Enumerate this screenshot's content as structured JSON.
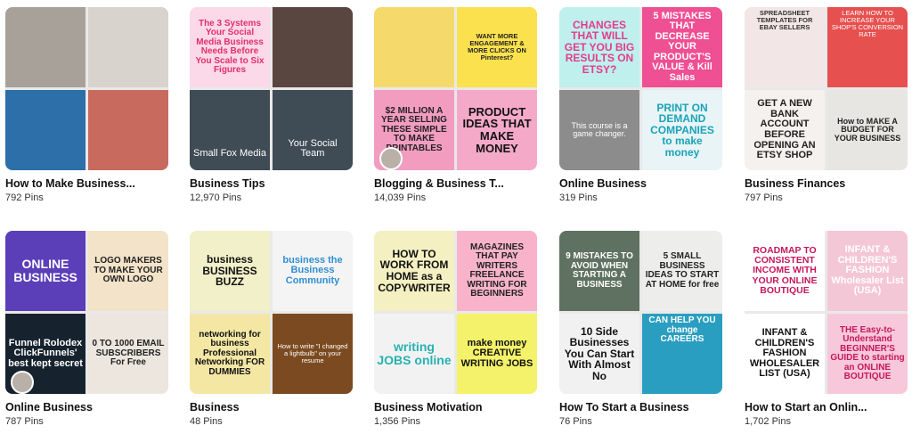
{
  "boards": [
    {
      "title": "How to Make Business...",
      "pins": "792 Pins",
      "tiles": [
        {
          "text": "",
          "bg": "#a7a19a",
          "color": "#fff"
        },
        {
          "text": "",
          "bg": "#d8d3cc",
          "color": "#fff"
        },
        {
          "text": "",
          "bg": "#2c6fa9",
          "color": "#fff"
        },
        {
          "text": "",
          "bg": "#c96a5e",
          "color": "#fff"
        }
      ]
    },
    {
      "title": "Business Tips",
      "pins": "12,970 Pins",
      "tiles": [
        {
          "text": "The 3 Systems Your Social Media Business Needs Before You Scale to Six Figures",
          "bg": "#fbd9e8",
          "color": "#e0306b"
        },
        {
          "text": "",
          "bg": "#5a4640",
          "color": "#fff"
        },
        {
          "text": "Small Fox Media",
          "bg": "#3f4b55",
          "color": "#ffffff"
        },
        {
          "text": "Your Social Team",
          "bg": "#3f4b55",
          "color": "#ffffff"
        }
      ]
    },
    {
      "title": "Blogging & Business T...",
      "pins": "14,039 Pins",
      "tiles": [
        {
          "text": "",
          "bg": "#f6d96b",
          "color": "#fff"
        },
        {
          "text": "WANT MORE ENGAGEMENT & MORE CLICKS ON Pinterest?",
          "bg": "#fbe14d",
          "color": "#222"
        },
        {
          "text": "$2 MILLION A YEAR SELLING THESE SIMPLE TO MAKE PRINTABLES",
          "bg": "#f29cc0",
          "color": "#222"
        },
        {
          "text": "PRODUCT IDEAS THAT MAKE MONEY",
          "bg": "#f5a9c9",
          "color": "#111"
        }
      ]
    },
    {
      "title": "Online Business",
      "pins": "319 Pins",
      "tiles": [
        {
          "text": "CHANGES THAT WILL GET YOU BIG RESULTS ON ETSY?",
          "bg": "#bff0ee",
          "color": "#e23c8c"
        },
        {
          "text": "5 MISTAKES THAT DECREASE YOUR PRODUCT'S VALUE & Kill Sales",
          "bg": "#ef4f93",
          "color": "#ffffff"
        },
        {
          "text": "This course is a game changer.",
          "bg": "#8c8c8c",
          "color": "#ffffff"
        },
        {
          "text": "PRINT ON DEMAND COMPANIES to make money",
          "bg": "#e8f4f6",
          "color": "#1aa3b8"
        }
      ]
    },
    {
      "title": "Business Finances",
      "pins": "797 Pins",
      "tiles": [
        {
          "text": "SPREADSHEET TEMPLATES FOR EBAY SELLERS",
          "bg": "#f3e6e6",
          "color": "#333"
        },
        {
          "text": "LEARN HOW TO INCREASE YOUR SHOP'S CONVERSION RATE",
          "bg": "#e6504f",
          "color": "#ffffff"
        },
        {
          "text": "GET A NEW BANK ACCOUNT BEFORE OPENING AN ETSY SHOP",
          "bg": "#f4f1ee",
          "color": "#222"
        },
        {
          "text": "How to MAKE A BUDGET FOR YOUR BUSINESS",
          "bg": "#e8e6e3",
          "color": "#222"
        }
      ]
    },
    {
      "title": "Online Business",
      "pins": "787 Pins",
      "tiles": [
        {
          "text": "ONLINE BUSINESS",
          "bg": "#5b3fb8",
          "color": "#ffffff"
        },
        {
          "text": "LOGO MAKERS TO MAKE YOUR OWN LOGO",
          "bg": "#f3e3c8",
          "color": "#222"
        },
        {
          "text": "Funnel Rolodex ClickFunnels' best kept secret",
          "bg": "#16232f",
          "color": "#ffffff"
        },
        {
          "text": "0 TO 1000 EMAIL SUBSCRIBERS For Free",
          "bg": "#ece6df",
          "color": "#222"
        }
      ]
    },
    {
      "title": "Business",
      "pins": "48 Pins",
      "tiles": [
        {
          "text": "business BUSINESS BUZZ",
          "bg": "#f2f0c8",
          "color": "#111"
        },
        {
          "text": "business the Business Community",
          "bg": "#f4f4f4",
          "color": "#2f8fd3"
        },
        {
          "text": "networking for business Professional Networking FOR DUMMIES",
          "bg": "#f4e7a4",
          "color": "#111"
        },
        {
          "text": "How to write \"I changed a lightbulb\" on your resume",
          "bg": "#7b4a20",
          "color": "#ffffff"
        }
      ]
    },
    {
      "title": "Business Motivation",
      "pins": "1,356 Pins",
      "tiles": [
        {
          "text": "HOW TO WORK FROM HOME as a COPYWRITER",
          "bg": "#f4f0c2",
          "color": "#111"
        },
        {
          "text": "MAGAZINES THAT PAY WRITERS FREELANCE WRITING FOR BEGINNERS",
          "bg": "#f8b3cb",
          "color": "#222"
        },
        {
          "text": "writing JOBS online",
          "bg": "#f2f2f2",
          "color": "#27b2b2"
        },
        {
          "text": "make money CREATIVE WRITING JOBS",
          "bg": "#f4f26a",
          "color": "#111"
        }
      ]
    },
    {
      "title": "How To Start a Business",
      "pins": "76 Pins",
      "tiles": [
        {
          "text": "9 MISTAKES TO AVOID WHEN STARTING A BUSINESS",
          "bg": "#5f7160",
          "color": "#ffffff"
        },
        {
          "text": "5 SMALL BUSINESS IDEAS TO START AT HOME for free",
          "bg": "#ededeb",
          "color": "#222"
        },
        {
          "text": "10 Side Businesses You Can Start With Almost No",
          "bg": "#f1f1f1",
          "color": "#111"
        },
        {
          "text": "CAN HELP YOU change CAREERS",
          "bg": "#2a9ec0",
          "color": "#ffffff"
        }
      ]
    },
    {
      "title": "How to Start an Onlin...",
      "pins": "1,702 Pins",
      "tiles": [
        {
          "text": "ROADMAP TO CONSISTENT INCOME WITH YOUR ONLINE BOUTIQUE",
          "bg": "#ffffff",
          "color": "#c5175e"
        },
        {
          "text": "INFANT & CHILDREN'S FASHION Wholesaler List (USA)",
          "bg": "#f4c7d7",
          "color": "#ffffff"
        },
        {
          "text": "INFANT & CHILDREN'S FASHION WHOLESALER LIST (USA)",
          "bg": "#ffffff",
          "color": "#111"
        },
        {
          "text": "THE Easy-to-Understand BEGINNER'S GUIDE to starting an ONLINE BOUTIQUE",
          "bg": "#f6c8da",
          "color": "#c5175e"
        }
      ]
    }
  ],
  "avatar_color": "#b9b0a8"
}
